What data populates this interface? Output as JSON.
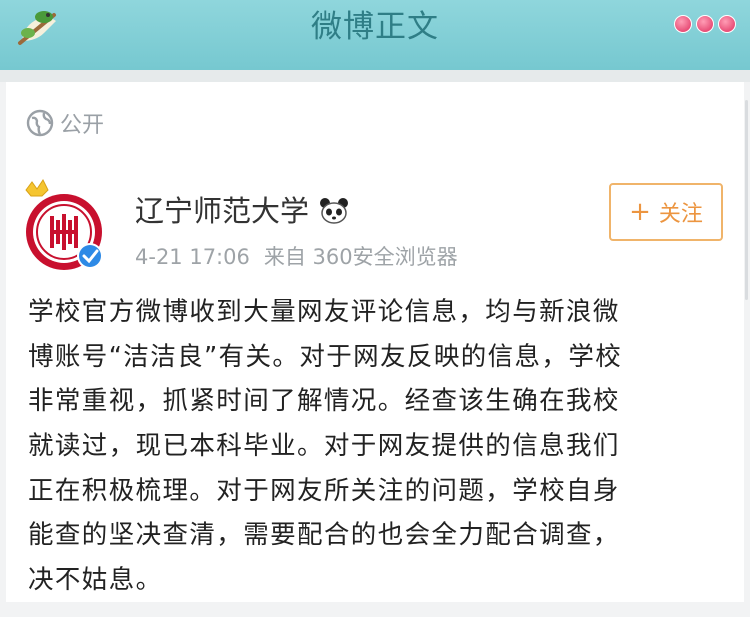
{
  "header": {
    "title": "微博正文",
    "back_icon": "bird-back-icon",
    "more_icon": "more-dots-icon"
  },
  "post": {
    "visibility": "公开",
    "author": {
      "name": "辽宁师范大学",
      "badge_icon": "panda-icon",
      "avatar_icon": "university-logo",
      "verified_icon": "verified-badge-icon",
      "crown_icon": "crown-icon"
    },
    "time": "4-21 17:06",
    "source": "来自 360安全浏览器",
    "follow_button": {
      "icon": "+",
      "label": "关注"
    },
    "content_lines": [
      "学校官方微博收到大量网友评论信息，均与新浪微",
      "博账号“洁洁良”有关。对于网友反映的信息，学校",
      "非常重视，抓紧时间了解情况。经查该生确在我校",
      "就读过，现已本科毕业。对于网友提供的信息我们",
      "正在积极梳理。对于网友所关注的问题，学校自身",
      "能查的坚决查清，需要配合的也会全力配合调查，",
      "决不姑息。"
    ]
  },
  "colors": {
    "header_bg": "#7ccbd2",
    "header_title": "#2f7e86",
    "follow_accent": "#ec9540",
    "meta_text": "#9ea3a7"
  }
}
